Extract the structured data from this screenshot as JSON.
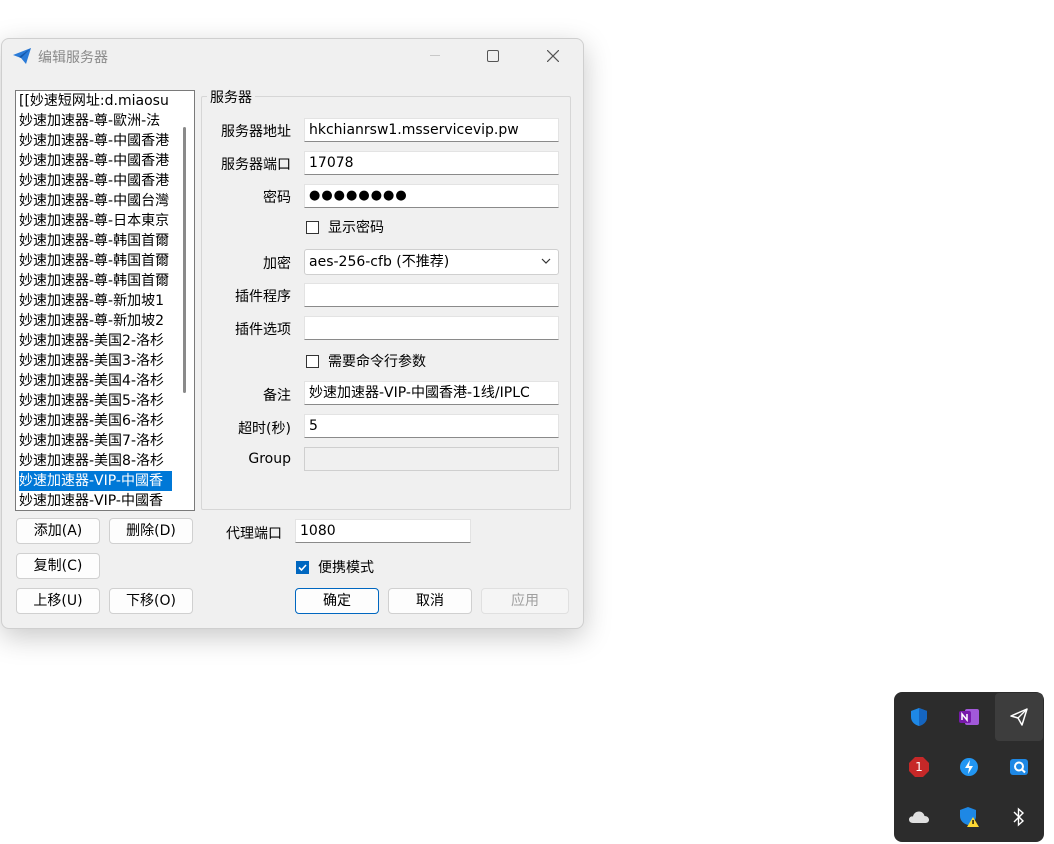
{
  "dialog": {
    "title": "编辑服务器",
    "server_list": [
      "[[妙速短网址:d.miaosu",
      "妙速加速器-尊-歐洲-法",
      "妙速加速器-尊-中國香港",
      "妙速加速器-尊-中國香港",
      "妙速加速器-尊-中國香港",
      "妙速加速器-尊-中國台灣",
      "妙速加速器-尊-日本東京",
      "妙速加速器-尊-韩国首爾",
      "妙速加速器-尊-韩国首爾",
      "妙速加速器-尊-韩国首爾",
      "妙速加速器-尊-新加坡1",
      "妙速加速器-尊-新加坡2",
      "妙速加速器-美国2-洛杉",
      "妙速加速器-美国3-洛杉",
      "妙速加速器-美国4-洛杉",
      "妙速加速器-美国5-洛杉",
      "妙速加速器-美国6-洛杉",
      "妙速加速器-美国7-洛杉",
      "妙速加速器-美国8-洛杉",
      "妙速加速器-VIP-中國香",
      "妙速加速器-VIP-中國香"
    ],
    "selected_index": 19,
    "server_group_title": "服务器",
    "labels": {
      "address": "服务器地址",
      "port": "服务器端口",
      "password": "密码",
      "show_password": "显示密码",
      "encryption": "加密",
      "plugin": "插件程序",
      "plugin_options": "插件选项",
      "need_cmd_args": "需要命令行参数",
      "remarks": "备注",
      "timeout": "超时(秒)",
      "group": "Group",
      "proxy_port": "代理端口",
      "portable_mode": "便携模式"
    },
    "values": {
      "address": "hkchianrsw1.msservicevip.pw",
      "port": "17078",
      "password": "●●●●●●●●",
      "encryption": "aes-256-cfb (不推荐)",
      "plugin": "",
      "plugin_options": "",
      "remarks": "妙速加速器-VIP-中國香港-1线/IPLC",
      "timeout": "5",
      "group": "",
      "proxy_port": "1080"
    },
    "checkboxes": {
      "show_password": false,
      "need_cmd_args": false,
      "portable_mode": true
    },
    "buttons": {
      "add": "添加(A)",
      "delete": "删除(D)",
      "copy": "复制(C)",
      "move_up": "上移(U)",
      "move_down": "下移(O)",
      "ok": "确定",
      "cancel": "取消",
      "apply": "应用"
    }
  },
  "tray": {
    "icons": [
      "shield-icon",
      "onenote-icon",
      "paper-plane-icon",
      "notification-badge-icon",
      "lightning-icon",
      "search-app-icon",
      "cloud-icon",
      "shield-warning-icon",
      "bluetooth-icon"
    ],
    "badge_count": "1"
  },
  "colors": {
    "accent": "#0067c0",
    "selection": "#0078d7",
    "dialog_bg": "#f0f0f0",
    "tray_bg": "#2c2c2c"
  }
}
